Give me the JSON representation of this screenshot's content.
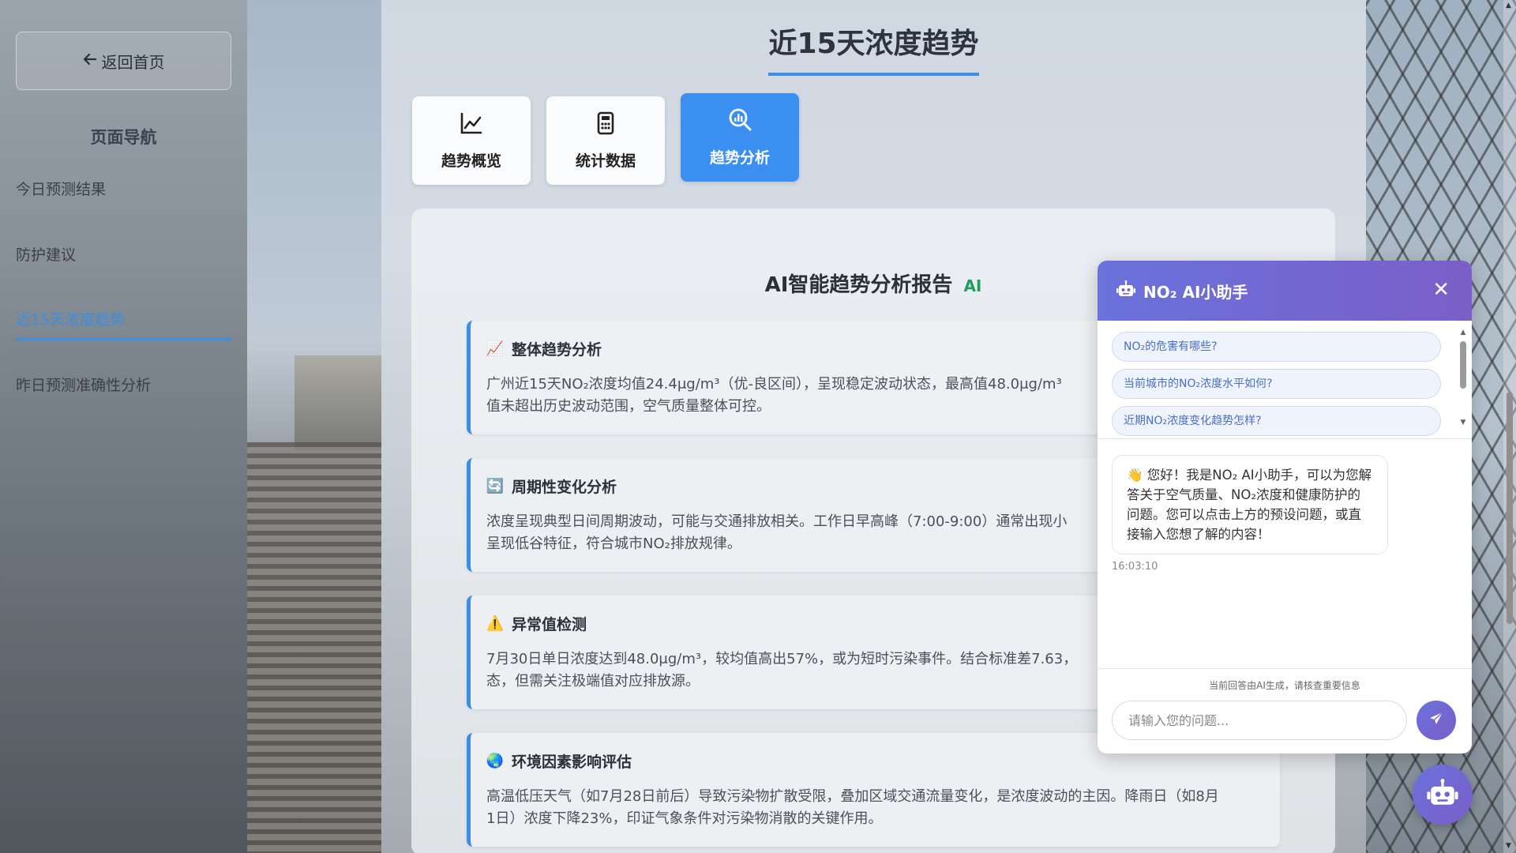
{
  "sidebar": {
    "back_label": "返回首页",
    "nav_title": "页面导航",
    "items": [
      {
        "label": "今日预测结果"
      },
      {
        "label": "防护建议"
      },
      {
        "label": "近15天浓度趋势"
      },
      {
        "label": "昨日预测准确性分析"
      }
    ]
  },
  "main": {
    "title": "近15天浓度趋势",
    "tabs": [
      {
        "label": "趋势概览",
        "icon": "line-chart-icon"
      },
      {
        "label": "统计数据",
        "icon": "calculator-icon"
      },
      {
        "label": "趋势分析",
        "icon": "search-chart-icon"
      }
    ],
    "active_tab": "趋势分析",
    "report": {
      "title": "AI智能趋势分析报告",
      "badge": "AI",
      "cards": [
        {
          "icon": "📈",
          "title": "整体趋势分析",
          "line1": "广州近15天NO₂浓度均值24.4μg/m³（优-良区间），呈现稳定波动状态，最高值48.0μg/m³",
          "line2": "值未超出历史波动范围，空气质量整体可控。"
        },
        {
          "icon": "🔄",
          "title": "周期性变化分析",
          "line1": "浓度呈现典型日间周期波动，可能与交通排放相关。工作日早高峰（7:00-9:00）通常出现小",
          "line2": "呈现低谷特征，符合城市NO₂排放规律。"
        },
        {
          "icon": "⚠️",
          "title": "异常值检测",
          "line1": "7月30日单日浓度达到48.0μg/m³，较均值高出57%，或为短时污染事件。结合标准差7.63，",
          "line2": "态，但需关注极端值对应排放源。"
        },
        {
          "icon": "🌏",
          "title": "环境因素影响评估",
          "line1": "高温低压天气（如7月28日前后）导致污染物扩散受限，叠加区域交通流量变化，是浓度波动的主因。降雨日（如8月",
          "line2": "1日）浓度下降23%，印证气象条件对污染物消散的关键作用。"
        }
      ]
    }
  },
  "chat": {
    "title": "NO₂ AI小助手",
    "close_label": "✕",
    "quick_questions": [
      "NO₂的危害有哪些?",
      "当前城市的NO₂浓度水平如何?",
      "近期NO₂浓度变化趋势怎样?"
    ],
    "greeting": "👋 您好！我是NO₂ AI小助手，可以为您解答关于空气质量、NO₂浓度和健康防护的问题。您可以点击上方的预设问题，或直接输入您想了解的内容！",
    "timestamp": "16:03:10",
    "notice": "当前回答由AI生成，请核查重要信息",
    "input_placeholder": "请输入您的问题...",
    "accent_gradient": [
      "#6a72dc",
      "#7b5ec8"
    ]
  },
  "colors": {
    "accent": "#3a8ee6",
    "active_tab": "#3b8ff0",
    "ai_badge": "#1f9e5c"
  }
}
